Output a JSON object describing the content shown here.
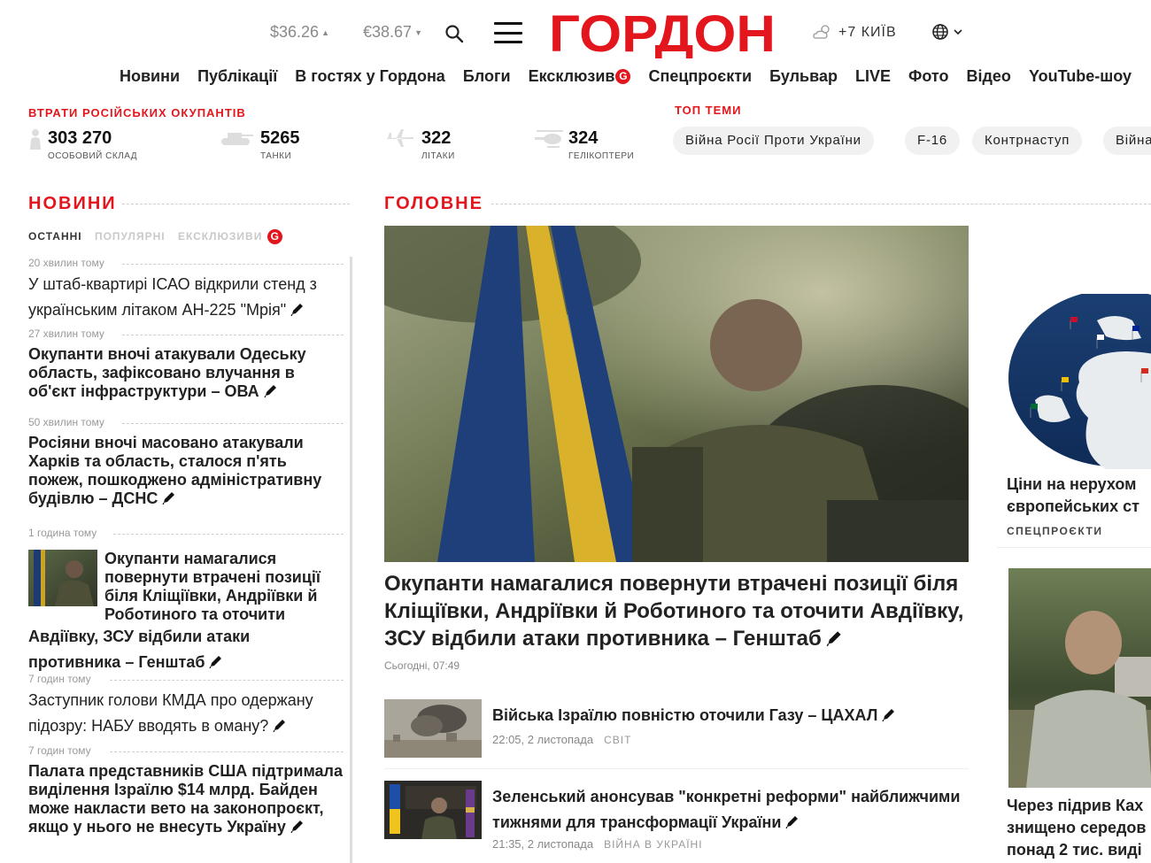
{
  "header": {
    "usd_rate": "$36.26",
    "eur_rate": "€38.67",
    "logo_text": "ГОРДОН",
    "weather_temp": "+7",
    "weather_city": "КИЇВ",
    "brand_color": "#e4161d",
    "icons": [
      "search-icon",
      "menu-icon",
      "weather-icon",
      "globe-icon",
      "chevron-down-icon"
    ]
  },
  "nav": {
    "items": [
      "Новини",
      "Публікації",
      "В гостях у Гордона",
      "Блоги",
      "Ексклюзив",
      "Спецпроєкти",
      "Бульвар",
      "LIVE",
      "Фото",
      "Відео",
      "YouTube-шоу"
    ],
    "exclusive_badge": "G"
  },
  "losses": {
    "title": "ВТРАТИ РОСІЙСЬКИХ ОКУПАНТІВ",
    "items": [
      {
        "value": "303 270",
        "label": "ОСОБОВИЙ СКЛАД"
      },
      {
        "value": "5265",
        "label": "ТАНКИ"
      },
      {
        "value": "322",
        "label": "ЛІТАКИ"
      },
      {
        "value": "324",
        "label": "ГЕЛІКОПТЕРИ"
      }
    ]
  },
  "top_topics": {
    "title": "ТОП ТЕМИ",
    "items": [
      "Війна Росії Проти України",
      "F-16",
      "Контрнаступ",
      "Війна"
    ]
  },
  "news": {
    "title": "НОВИНИ",
    "tabs": [
      "ОСТАННІ",
      "ПОПУЛЯРНІ",
      "ЕКСКЛЮЗИВИ"
    ],
    "tab_badge": "G",
    "items": [
      {
        "time": "20 хвилин тому",
        "title": "У штаб-квартирі ІСАО відкрили стенд з українським літаком АН-225 \"Мрія\""
      },
      {
        "time": "27 хвилин тому",
        "title": "Окупанти вночі атакували Одеську область, зафіксовано влучання в об'єкт інфраструктури – ОВА"
      },
      {
        "time": "50 хвилин тому",
        "title": "Росіяни вночі масовано атакували Харків та область, сталося п'ять пожеж, пошкоджено адміністративну будівлю – ДСНС"
      },
      {
        "time": "1 година тому",
        "title_a": "Окупанти намагалися повернути втрачені позиції біля Кліщіївки, Андріївки й Роботиного та оточити",
        "title_b": "Авдіївку, ЗСУ відбили атаки противника – Генштаб"
      },
      {
        "time": "7 годин тому",
        "title": "Заступник голови КМДА про одержану підозру: НАБУ вводять в оману?"
      },
      {
        "time": "7 годин тому",
        "title": "Палата представників США підтримала виділення Ізраїлю $14 млрд. Байден може накласти вето на законопроєкт, якщо у нього не внесуть Україну"
      }
    ]
  },
  "main": {
    "title": "ГОЛОВНЕ",
    "hero_title": "Окупанти намагалися повернути втрачені позиції біля Кліщіївки, Андріївки й Роботиного та оточити Авдіївку, ЗСУ відбили атаки противника – Генштаб",
    "hero_date": "Сьогодні, 07:49",
    "stories": [
      {
        "title": "Війська Ізраїлю повністю оточили Газу – ЦАХАЛ",
        "date": "22:05, 2 листопада",
        "category": "СВІТ"
      },
      {
        "title": "Зеленський анонсував \"конкретні реформи\" найближчими тижнями для трансформації України",
        "date": "21:35, 2 листопада",
        "category": "ВІЙНА В УКРАЇНІ"
      }
    ]
  },
  "right": {
    "card1_line1": "Ціни на нерухом",
    "card1_line2": "європейських ст",
    "card1_category": "СПЕЦПРОЄКТИ",
    "card2_line1": "Через підрив Ках",
    "card2_line2": "знищено середов",
    "card2_line3": "понад 2 тис. виді"
  }
}
